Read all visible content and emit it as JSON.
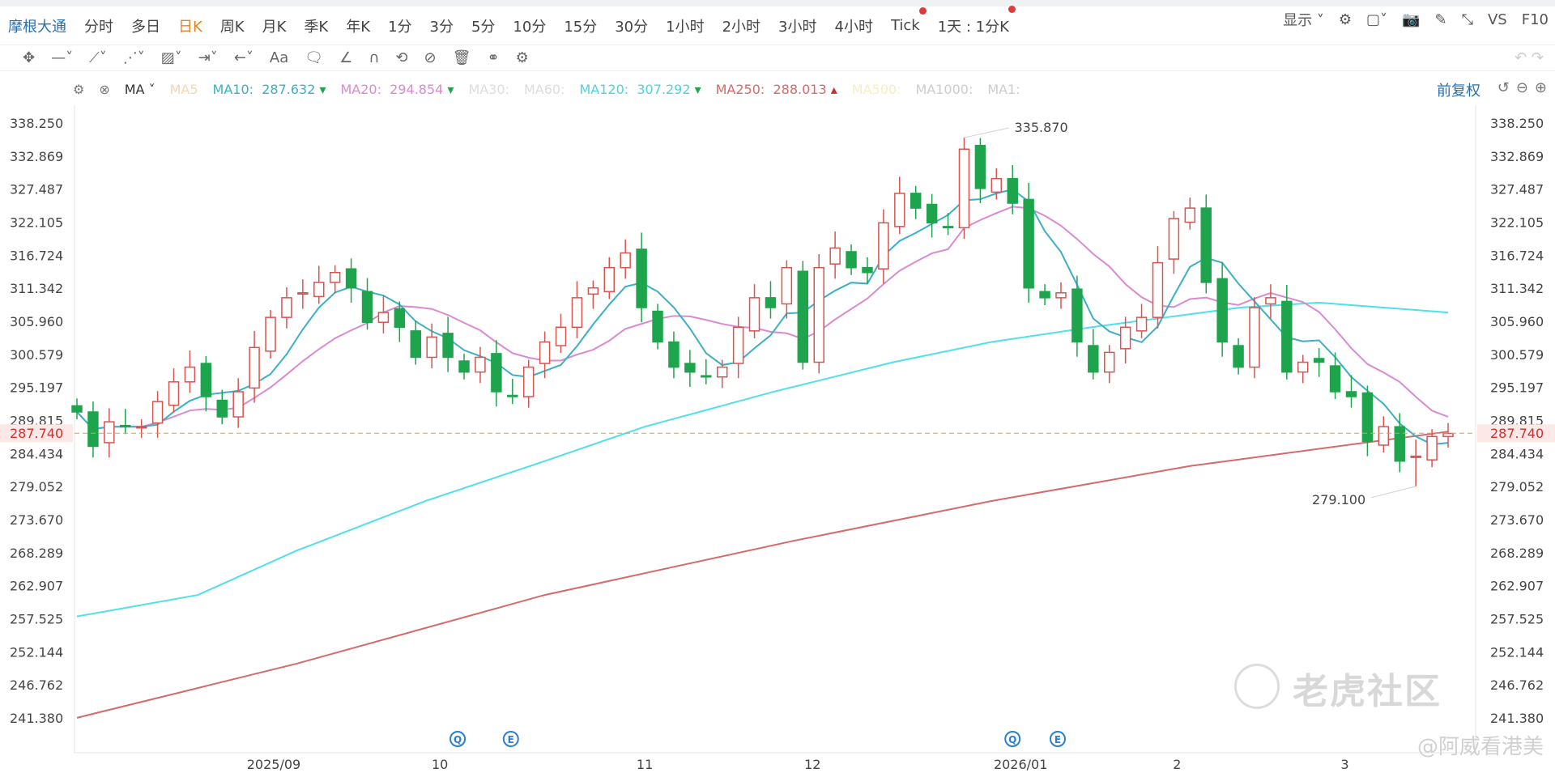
{
  "tabs": [
    "摩根大通",
    "分时",
    "多日",
    "日K",
    "周K",
    "月K",
    "季K",
    "年K",
    "1分",
    "3分",
    "5分",
    "10分",
    "15分",
    "30分",
    "1小时",
    "2小时",
    "3小时",
    "4小时",
    "Tick",
    "1天 : 1分K"
  ],
  "active_tab": "日K",
  "right_tools": {
    "display": "显示",
    "vs": "VS",
    "f10": "F10"
  },
  "toolbar_icons": [
    "move-icon",
    "line-icon",
    "polyline-icon",
    "wave-icon",
    "fib-icon",
    "range-icon",
    "arrow-icon",
    "text-icon",
    "comment-icon",
    "angle-icon",
    "magnet-icon",
    "sync-icon",
    "hide-icon",
    "trash-icon",
    "overlay-icon",
    "settings-icon"
  ],
  "toolbar_text": "Aa",
  "ma": {
    "label": "MA",
    "ma5": "MA5",
    "ma10_label": "MA10:",
    "ma10": "287.632",
    "ma20_label": "MA20:",
    "ma20": "294.854",
    "ma30": "MA30:",
    "ma60": "MA60:",
    "ma120_label": "MA120:",
    "ma120": "307.292",
    "ma250_label": "MA250:",
    "ma250": "288.013",
    "ma500": "MA500:",
    "ma1000": "MA1000:",
    "ma1": "MA1:"
  },
  "adjust": "前复权",
  "colors": {
    "up": "#d9534f",
    "down": "#1ea44d",
    "ma10": "#3bb0c4",
    "ma20": "#d98ad0",
    "ma120": "#4fe0e8",
    "ma250": "#d46a6a",
    "accent": "#2a6fb0"
  },
  "watermark": "老虎社区",
  "credit": "@阿威看港美",
  "chart_data": {
    "type": "candlestick",
    "y_ticks": [
      "338.250",
      "332.869",
      "327.487",
      "322.105",
      "316.724",
      "311.342",
      "305.960",
      "300.579",
      "295.197",
      "289.815",
      "284.434",
      "279.052",
      "273.670",
      "268.289",
      "262.907",
      "257.525",
      "252.144",
      "246.762",
      "241.380"
    ],
    "ylim": [
      241.38,
      338.25
    ],
    "last_price": "287.740",
    "high_label": "335.870",
    "high_index": 55,
    "high_value": 335.87,
    "low_label": "279.100",
    "low_index": 83,
    "low_value": 279.1,
    "x_labels": [
      {
        "label": "2025/09",
        "index": 12.2
      },
      {
        "label": "10",
        "index": 22.5
      },
      {
        "label": "11",
        "index": 35.2
      },
      {
        "label": "12",
        "index": 45.6
      },
      {
        "label": "2026/01",
        "index": 58.5
      },
      {
        "label": "2",
        "index": 68.2
      },
      {
        "label": "3",
        "index": 78.6
      }
    ],
    "events": [
      {
        "label": "Q",
        "index": 23.6
      },
      {
        "label": "E",
        "index": 26.9
      },
      {
        "label": "Q",
        "index": 58
      },
      {
        "label": "E",
        "index": 60.8
      }
    ],
    "closes": [
      291.2,
      285.6,
      289.6,
      288.8,
      288.8,
      292.9,
      296.1,
      298.5,
      293.7,
      290.4,
      294.5,
      301.7,
      306.6,
      309.8,
      310.6,
      312.3,
      313.9,
      311.4,
      305.8,
      307.4,
      305,
      300.1,
      303.4,
      300.1,
      297.7,
      300.1,
      294.5,
      293.7,
      298.5,
      302.6,
      305,
      309.8,
      311.4,
      314.7,
      317.1,
      308.2,
      302.6,
      298.5,
      297.7,
      296.9,
      298.5,
      305,
      309.8,
      308.2,
      314.7,
      299.3,
      314.7,
      317.9,
      314.7,
      313.9,
      322,
      326.8,
      324.4,
      322,
      321.2,
      334,
      327.6,
      329.2,
      325.2,
      311.4,
      309.8,
      310.6,
      302.6,
      297.7,
      300.9,
      305,
      306.6,
      315.5,
      322.7,
      324.4,
      312.3,
      302.6,
      298.5,
      308.2,
      309.8,
      297.7,
      299.3,
      299.3,
      294.5,
      293.7,
      286.4,
      288.8,
      283.2,
      284,
      287.2,
      287.7
    ],
    "ma120_points": [
      [
        0,
        257.9
      ],
      [
        7.5,
        261.4
      ],
      [
        13.6,
        268.6
      ],
      [
        21.6,
        276.7
      ],
      [
        29,
        283.2
      ],
      [
        35.2,
        288.8
      ],
      [
        43.2,
        294.5
      ],
      [
        50.6,
        299.3
      ],
      [
        56.7,
        302.6
      ],
      [
        62.9,
        305
      ],
      [
        72.1,
        308.2
      ],
      [
        77,
        309
      ],
      [
        85,
        307.4
      ]
    ],
    "ma250_points": [
      [
        0,
        241.4
      ],
      [
        13.6,
        250.2
      ],
      [
        29,
        261.4
      ],
      [
        44.4,
        270.2
      ],
      [
        56.7,
        276.7
      ],
      [
        69,
        282.4
      ],
      [
        85,
        288
      ]
    ]
  }
}
